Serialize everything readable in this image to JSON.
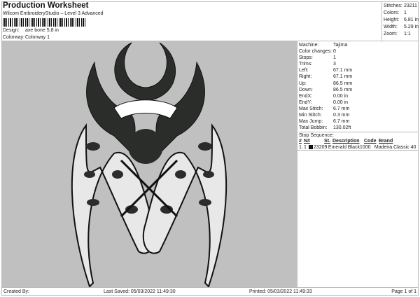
{
  "header": {
    "title": "Production Worksheet",
    "software": "Wilcom EmbroideryStudio – Level 3 Advanced",
    "design_label": "Design:",
    "design": "axe bone 5,8 in",
    "colorway_label": "Colorway:",
    "colorway": "Colorway 1"
  },
  "summary": [
    {
      "k": "Stitches:",
      "v": "23211"
    },
    {
      "k": "Colors:",
      "v": "1"
    },
    {
      "k": "Height:",
      "v": "6.81 in"
    },
    {
      "k": "Width:",
      "v": "5.29 in"
    },
    {
      "k": "Zoom:",
      "v": "1:1"
    }
  ],
  "details": [
    {
      "k": "Machine:",
      "v": "Tajima"
    },
    {
      "k": "Color changes:",
      "v": "0"
    },
    {
      "k": "Stops:",
      "v": "1"
    },
    {
      "k": "Trims:",
      "v": "3"
    },
    {
      "k": "Left:",
      "v": "67.1 mm"
    },
    {
      "k": "Right:",
      "v": "67.1 mm"
    },
    {
      "k": "Up:",
      "v": "86.5 mm"
    },
    {
      "k": "Down:",
      "v": "86.5 mm"
    },
    {
      "k": "EndX:",
      "v": "0.00 in"
    },
    {
      "k": "EndY:",
      "v": "0.00 in"
    },
    {
      "k": "Max Stitch:",
      "v": "6.7 mm"
    },
    {
      "k": "Min Stitch:",
      "v": "0.3 mm"
    },
    {
      "k": "Max Jump:",
      "v": "6.7 mm"
    },
    {
      "k": "Total Bobbin:",
      "v": "130.02ft"
    }
  ],
  "stop_sequence": {
    "title": "Stop Sequence:",
    "headers": [
      "#",
      "N#",
      "St.",
      "Description",
      "Code",
      "Brand"
    ],
    "rows": [
      {
        "n": "1.",
        "nn": "1",
        "color": "#111111",
        "st": "23209",
        "desc": "Emerald Black",
        "code": "1000",
        "brand": "Madeira Classic 40"
      }
    ]
  },
  "footer": {
    "created": "Created By:",
    "saved": "Last Saved: 05/03/2022 11:49:30",
    "printed": "Printed: 05/03/2022 11:49:33",
    "page": "Page 1 of 1"
  }
}
